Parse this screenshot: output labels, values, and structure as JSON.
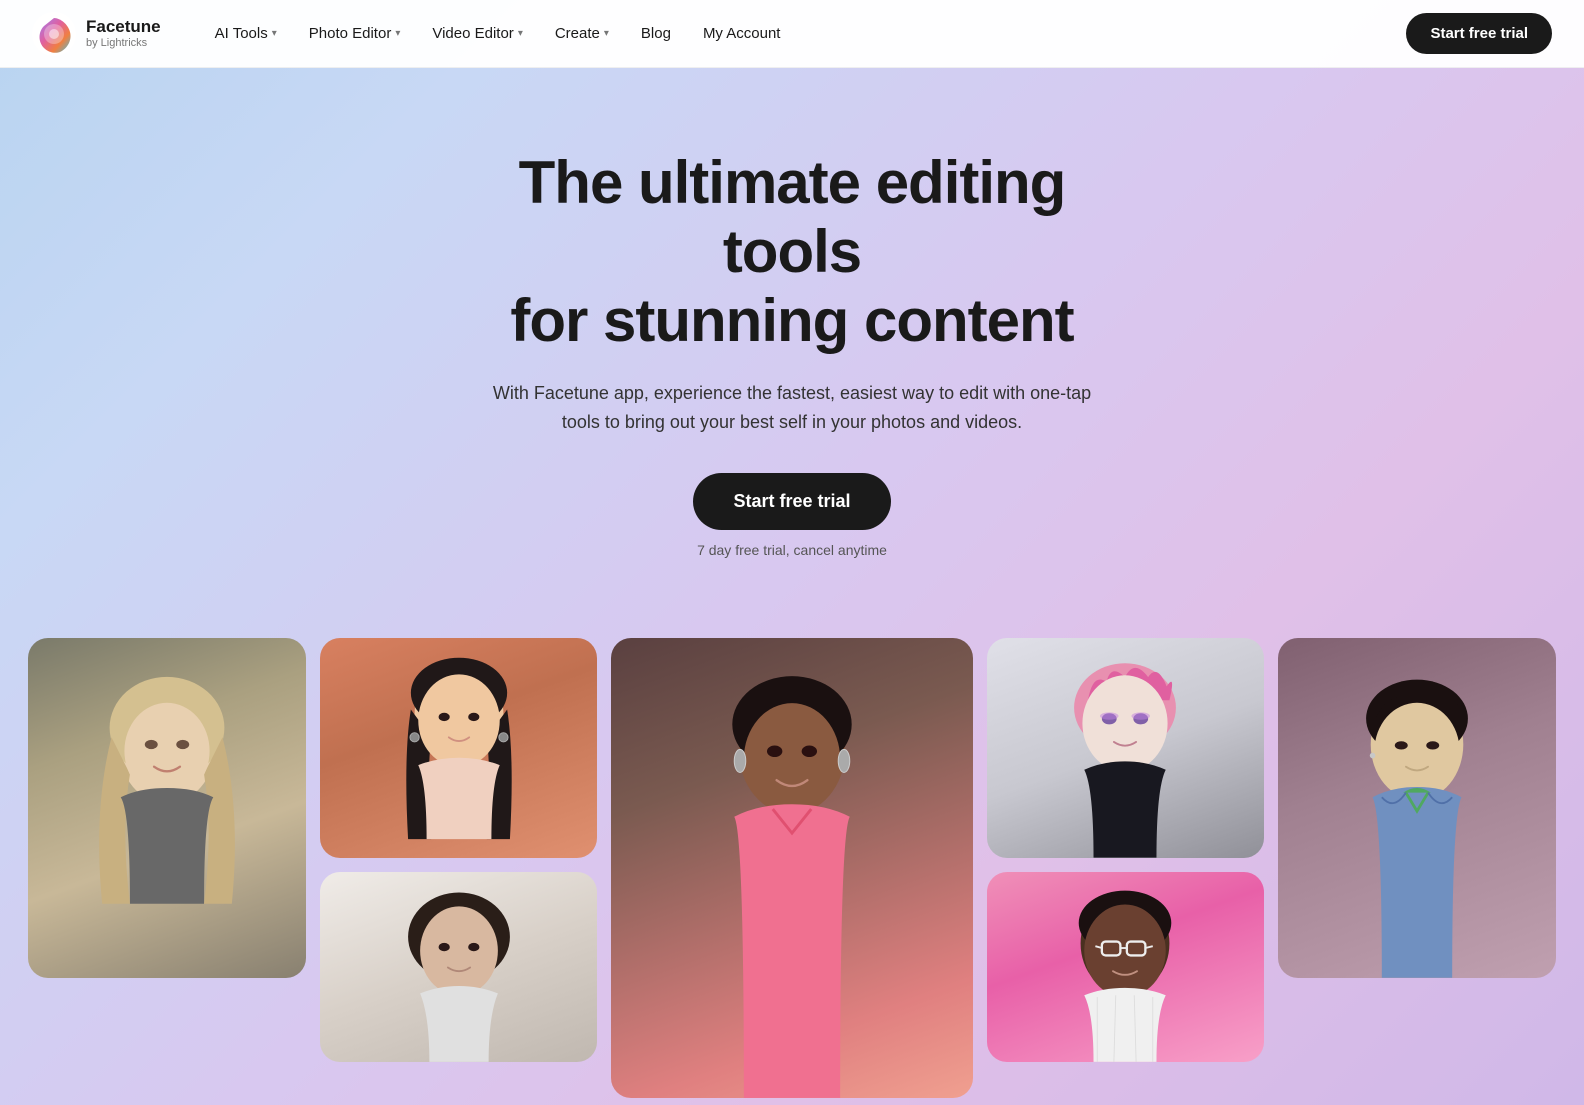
{
  "logo": {
    "name": "Facetune",
    "sub": "by Lightricks"
  },
  "nav": {
    "items": [
      {
        "label": "AI Tools",
        "hasDropdown": true
      },
      {
        "label": "Photo Editor",
        "hasDropdown": true
      },
      {
        "label": "Video Editor",
        "hasDropdown": true
      },
      {
        "label": "Create",
        "hasDropdown": true
      },
      {
        "label": "Blog",
        "hasDropdown": false
      },
      {
        "label": "My Account",
        "hasDropdown": false
      }
    ],
    "cta": "Start free trial"
  },
  "hero": {
    "title_line1": "The ultimate editing tools",
    "title_line2": "for stunning content",
    "subtitle": "With Facetune app, experience the fastest, easiest way to edit with one-tap tools to bring out your best self in your photos and videos.",
    "cta_label": "Start free trial",
    "cta_note": "7 day free trial, cancel anytime"
  },
  "photos": [
    {
      "id": "photo-blonde-woman",
      "alt": "Blonde woman smiling",
      "size": "tall",
      "gradient": "linear-gradient(160deg, #7a7a6a 0%, #aaa080 30%, #c8b898 60%, #888070 100%)"
    },
    {
      "id": "photo-asian-woman",
      "alt": "Asian woman portrait",
      "size": "medium",
      "gradient": "linear-gradient(160deg, #d88060 0%, #c07050 40%, #e09070 100%)"
    },
    {
      "id": "photo-woman-curly",
      "alt": "Woman with curly hair",
      "size": "short",
      "gradient": "linear-gradient(160deg, #f0ece8 0%, #d8d0c8 50%, #c0b8b0 100%)"
    },
    {
      "id": "photo-dark-woman",
      "alt": "Dark-skinned woman in pink",
      "size": "big",
      "gradient": "linear-gradient(160deg, #5a4040 0%, #7a5a50 30%, #e08080 80%, #f0a090 100%)"
    },
    {
      "id": "photo-pink-hair",
      "alt": "Person with pink hair",
      "size": "medium",
      "gradient": "linear-gradient(160deg, #e0e0e8 0%, #c8c8d0 50%, #909098 100%)"
    },
    {
      "id": "photo-man-pink-bg",
      "alt": "Man with glasses on pink background",
      "size": "short",
      "gradient": "linear-gradient(160deg, #f080b0 0%, #e060a0 40%, #f090c0 100%)"
    },
    {
      "id": "photo-asian-man",
      "alt": "Asian man in denim jacket",
      "size": "tall",
      "gradient": "linear-gradient(160deg, #806070 0%, #a08090 40%, #c0a0b0 100%)"
    }
  ]
}
